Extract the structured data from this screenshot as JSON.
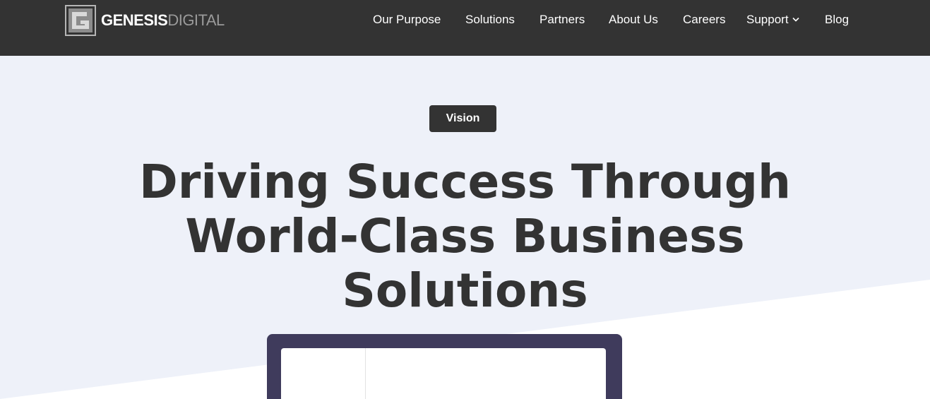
{
  "brand": {
    "name_bold": "GENESIS",
    "name_light": "DIGITAL",
    "colors": {
      "dark": "#333333",
      "hero_bg": "#eef1f9",
      "device": "#3f3b5c",
      "logo_grey": "#9a9a9a"
    }
  },
  "nav": {
    "items": [
      {
        "label": "Our Purpose"
      },
      {
        "label": "Solutions"
      },
      {
        "label": "Partners"
      },
      {
        "label": "About Us"
      },
      {
        "label": "Careers"
      },
      {
        "label": "Support",
        "icon": "chevron-down-icon"
      },
      {
        "label": "Blog"
      }
    ]
  },
  "hero": {
    "badge": "Vision",
    "headline_line1": "Driving Success Through",
    "headline_line2": "World-Class Business",
    "headline_line3": "Solutions"
  }
}
